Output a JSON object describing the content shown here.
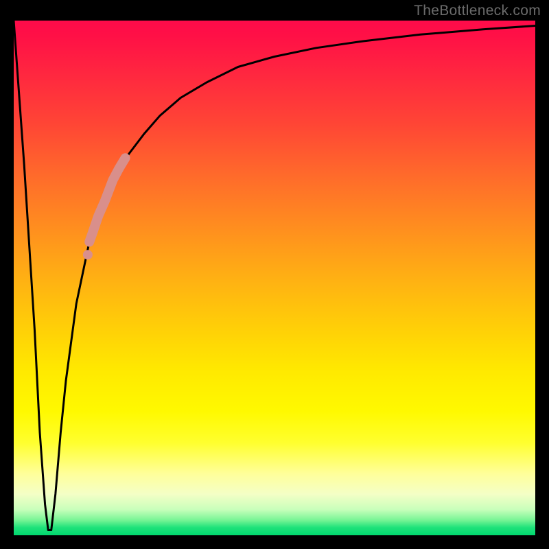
{
  "watermark": "TheBottleneck.com",
  "chart_data": {
    "type": "line",
    "title": "",
    "xlabel": "",
    "ylabel": "",
    "xlim": [
      0,
      100
    ],
    "ylim": [
      0,
      100
    ],
    "grid": false,
    "series": [
      {
        "name": "bottleneck-curve",
        "x": [
          0,
          2,
          4,
          5,
          6,
          6.6,
          7.2,
          8,
          9,
          10,
          12,
          14.5,
          16,
          18,
          20,
          22,
          25,
          28,
          32,
          37,
          43,
          50,
          58,
          67,
          78,
          90,
          100
        ],
        "values": [
          100,
          72,
          40,
          20,
          6,
          1,
          1,
          8,
          20,
          30,
          45,
          57,
          62,
          67,
          71,
          74,
          78,
          81.5,
          85,
          88,
          91,
          93,
          94.7,
          96,
          97.3,
          98.3,
          99
        ]
      }
    ],
    "highlight": {
      "name": "highlight-segment",
      "x": [
        14.5,
        15.2,
        16.2,
        17.5,
        19.0,
        20.2,
        21.4
      ],
      "values": [
        57,
        59,
        62,
        65,
        69,
        71.3,
        73.3
      ]
    },
    "background_gradient": {
      "stops": [
        {
          "pct": 0,
          "color": "#ff0b4a"
        },
        {
          "pct": 50,
          "color": "#ffb013"
        },
        {
          "pct": 82,
          "color": "#ffff2e"
        },
        {
          "pct": 100,
          "color": "#00d86e"
        }
      ]
    }
  }
}
